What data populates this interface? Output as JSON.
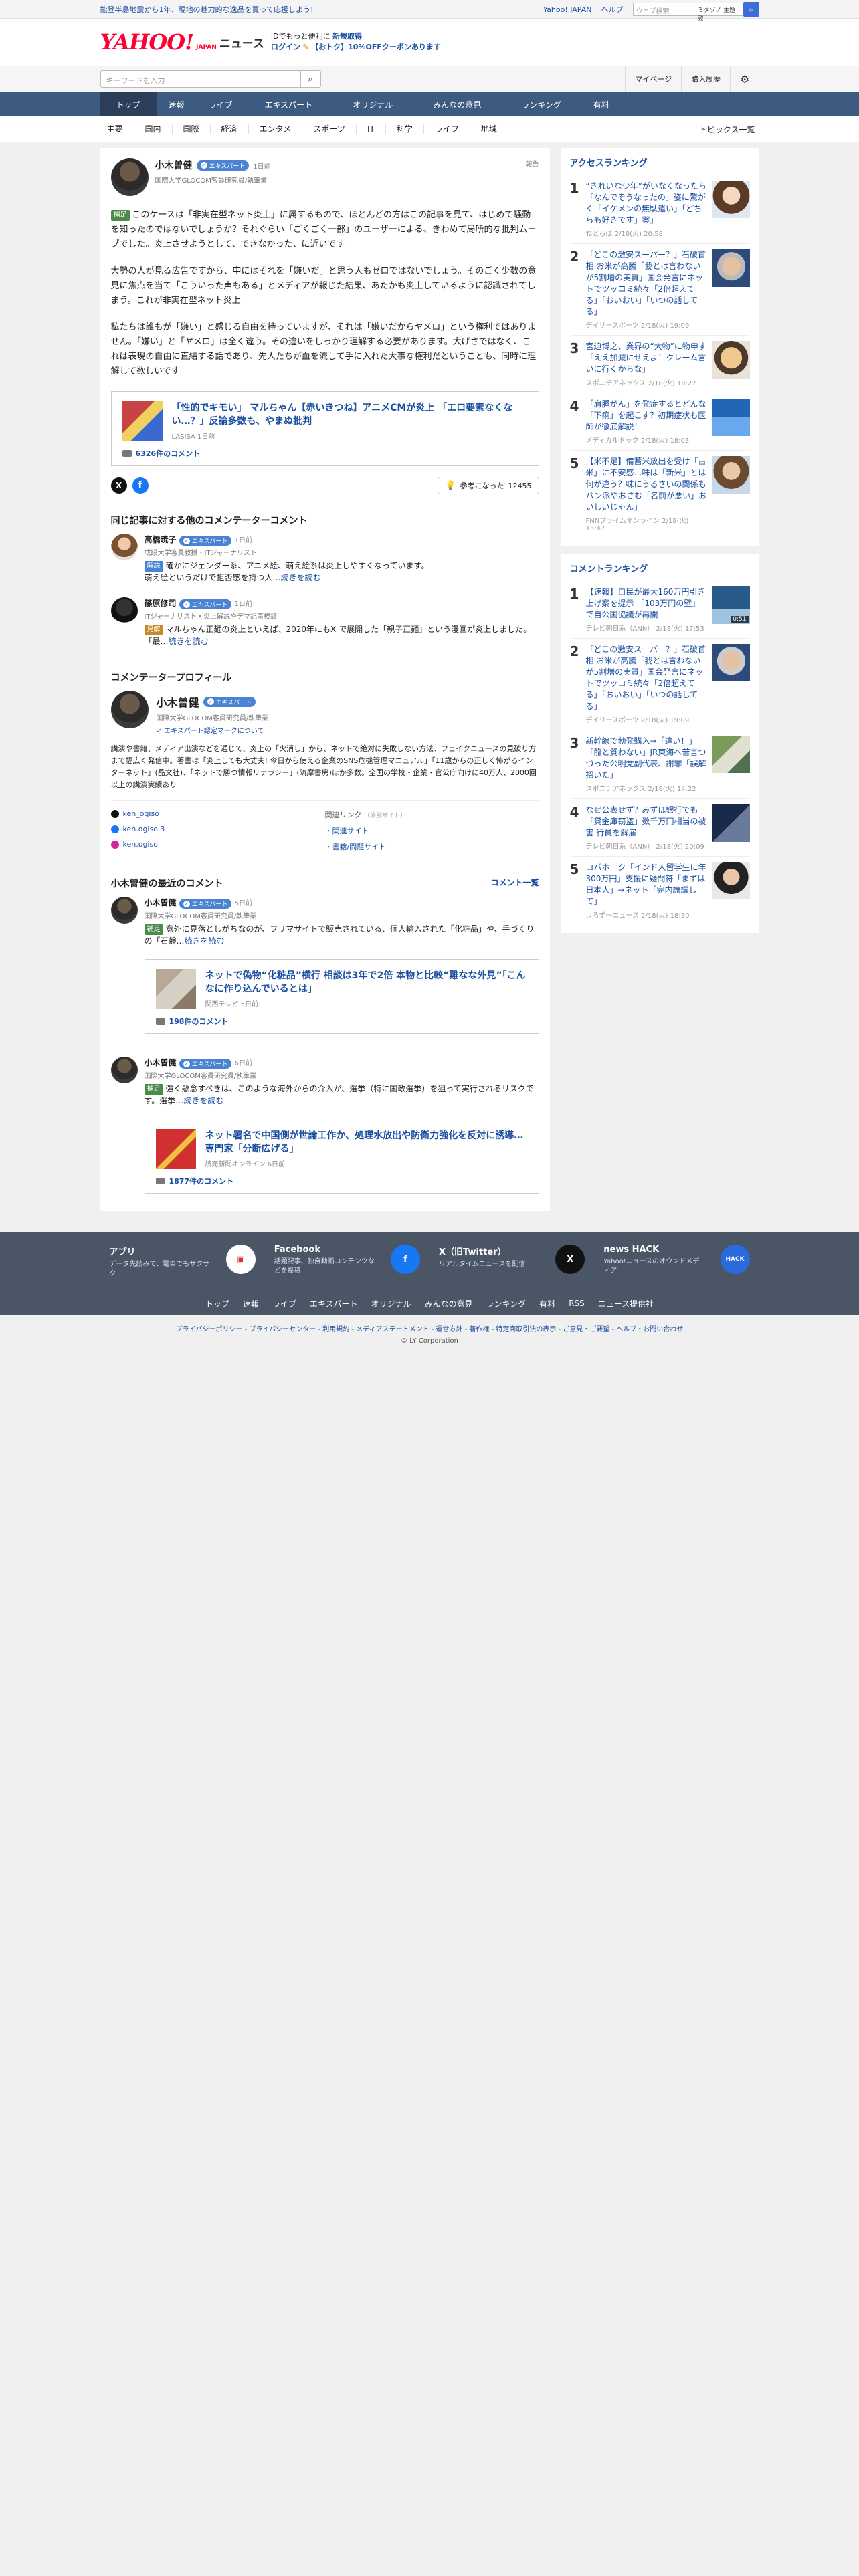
{
  "promo": {
    "text": "能登半島地震から1年、現地の魅力的な逸品を買って応援しよう!"
  },
  "topbar": {
    "yahoo_japan": "Yahoo! JAPAN",
    "help": "ヘルプ",
    "search_placeholder": "ウェブ検索",
    "search_scope": "ミタゾノ 主題歌"
  },
  "header": {
    "logo_main": "YAHOO!",
    "logo_sub": "JAPAN",
    "logo_news": "ニュース",
    "msg_line1": "IDでもっと便利に",
    "msg_line1_link": "新規取得",
    "msg_login": "ログイン",
    "msg_coupon": "【おトク】10%OFFクーポンあります"
  },
  "searchrow": {
    "placeholder": "キーワードを入力",
    "mypage": "マイページ",
    "history": "購入履歴"
  },
  "gnav": [
    "トップ",
    "速報",
    "ライブ",
    "エキスパート",
    "オリジナル",
    "みんなの意見",
    "ランキング",
    "有料"
  ],
  "snav": {
    "items": [
      "主要",
      "国内",
      "国際",
      "経済",
      "エンタメ",
      "スポーツ",
      "IT",
      "科学",
      "ライフ",
      "地域"
    ],
    "topics": "トピックス一覧"
  },
  "comment": {
    "author": "小木曽健",
    "badge": "エキスパート",
    "time": "1日前",
    "affiliation": "国際大学GLOCOM客員研究員/執筆業",
    "report": "報告",
    "tag": "補足",
    "p1": "このケースは「非実在型ネット炎上」に属するもので、ほとんどの方はこの記事を見て、はじめて騒動を知ったのではないでしょうか？それぐらい「ごくごく一部」のユーザーによる、きわめて局所的な批判ムーブでした。炎上させようとして、できなかった、に近いです",
    "p2": "大勢の人が見る広告ですから、中にはそれを「嫌いだ」と思う人もゼロではないでしょう。そのごく少数の意見に焦点を当て「こういった声もある」とメディアが報じた結果、あたかも炎上しているように認識されてしまう。これが非実在型ネット炎上",
    "p3": "私たちは誰もが「嫌い」と感じる自由を持っていますが、それは「嫌いだからヤメロ」という権利ではありません。「嫌い」と「ヤメロ」は全く違う。その違いをしっかり理解する必要があります。大げさではなく、これは表現の自由に直結する話であり、先人たちが血を流して手に入れた大事な権利だということも、同時に理解して欲しいです",
    "article_title": "「性的でキモい」 マルちゃん【赤いきつね】アニメCMが炎上 「エロ要素なくない…？」反論多数も、やまぬ批判",
    "article_source": "LASISA 1日前",
    "article_comments": "6326件のコメント",
    "helpful_label": "参考になった",
    "helpful_count": "12455"
  },
  "others": {
    "heading": "同じ記事に対する他のコメンテーターコメント",
    "items": [
      {
        "name": "高橋暁子",
        "badge": "エキスパート",
        "time": "1日前",
        "aff": "成蹊大学客員教授・ITジャーナリスト",
        "tag": "解説",
        "text": "確かにジェンダー系、アニメ絵、萌え絵系は炎上しやすくなっています。",
        "text2": "萌え絵というだけで拒否感を持つ人…",
        "more": "続きを読む"
      },
      {
        "name": "篠原修司",
        "badge": "エキスパート",
        "time": "1日前",
        "aff": "ITジャーナリスト・炎上解説やデマ記事検証",
        "tag": "見解",
        "text": "マルちゃん正麺の炎上といえば、2020年にもX で展開した「親子正麺」という漫画が炎上しました。",
        "text2": "「最…",
        "more": "続きを読む"
      }
    ]
  },
  "profile": {
    "heading": "コメンテータープロフィール",
    "name": "小木曽健",
    "badge": "エキスパート",
    "aff": "国際大学GLOCOM客員研究員/執筆業",
    "cert": "エキスパート認定マークについて",
    "bio": "講演や書籍、メディア出演などを通じて、炎上の「火消し」から、ネットで絶対に失敗しない方法、フェイクニュースの見破り方まで幅広く発信中。著書は「炎上しても大丈夫! 今日から使える企業のSNS危機管理マニュアル」「11歳からの正しく怖がるインターネット」(晶文社)、「ネットで勝つ情報リテラシー」(筑摩書房)ほか多数。全国の学校・企業・官公庁向けに40万人、2000回以上の講演実績あり",
    "sns": [
      "ken_ogiso",
      "ken.ogiso.3",
      "ken.ogiso"
    ],
    "rel_heading": "関連リンク",
    "rel_note": "（外部サイト）",
    "rel": [
      "関連サイト",
      "書籍/問題サイト"
    ]
  },
  "recent": {
    "heading": "小木曽健の最近のコメント",
    "more": "コメント一覧",
    "items": [
      {
        "name": "小木曽健",
        "badge": "エキスパート",
        "time": "5日前",
        "aff": "国際大学GLOCOM客員研究員/執筆業",
        "tag": "補足",
        "text": "意外に見落としがちなのが、フリマサイトで販売されている、個人輸入された「化粧品」や、手づくりの「石鹸…",
        "more": "続きを読む",
        "art_title": "ネットで偽物“化粧品”横行 相談は3年で2倍 本物と比較“難なな外見”「こんなに作り込んでいるとは」",
        "art_src": "関西テレビ 5日前",
        "art_cmt": "198件のコメント"
      },
      {
        "name": "小木曽健",
        "badge": "エキスパート",
        "time": "6日前",
        "aff": "国際大学GLOCOM客員研究員/執筆業",
        "tag": "補足",
        "text": "強く懸念すべきは、このような海外からの介入が、選挙（特に国政選挙）を狙って実行されるリスクです。選挙…",
        "more": "続きを読む",
        "art_title": "ネット署名で中国側が世論工作か、処理水放出や防衛力強化を反対に誘導…専門家「分断広げる」",
        "art_src": "読売新聞オンライン 6日前",
        "art_cmt": "1877件のコメント"
      }
    ]
  },
  "access_ranking": {
    "heading": "アクセスランキング",
    "items": [
      {
        "num": "1",
        "title": "“きれいな少年”がいなくなったら「なんでそうなったの」姿に驚がく「イケメンの無駄遣い」「どちらも好きです」案」",
        "meta": "ねとらぼ 2/18(火) 20:58"
      },
      {
        "num": "2",
        "title": "「どこの激安スーパー？」石破首相 お米が高騰「我とは言わないが5割増の実質」国会発言にネットでツッコミ続々「2倍超えてる」「おいおい」「いつの話してる」",
        "meta": "デイリースポーツ 2/18(火) 19:09"
      },
      {
        "num": "3",
        "title": "宮迫博之、業界の“大物”に物申す「ええ加減にせえよ！クレーム言いに行くからな」",
        "meta": "スポニチアネックス 2/18(火) 18:27"
      },
      {
        "num": "4",
        "title": "「肩腫がん」を発症するとどんな「下痢」を起こす？初期症状も医師が徹底解説！",
        "meta": "メディカルドック 2/18(火) 18:03"
      },
      {
        "num": "5",
        "title": "【米不足】備蓄米放出を受け「古米」に不安感…味は「新米」とは何が違う？味にうるさいの関係もパン派やおさむ「名前が悪い」おいしいじゃん」",
        "meta": "FNNプライムオンライン 2/18(火) 13:47"
      }
    ]
  },
  "comment_ranking": {
    "heading": "コメントランキング",
    "items": [
      {
        "num": "1",
        "title": "【速報】自民が最大160万円引き上げ案を提示 「103万円の壁」で自公国協議が再開",
        "meta": "テレビ朝日系（ANN） 2/18(火) 17:53",
        "time": "0:51"
      },
      {
        "num": "2",
        "title": "「どこの激安スーパー？」石破首相 お米が高騰「我とは言わないが5割増の実質」国会発言にネットでツッコミ続々「2倍超えてる」「おいおい」「いつの話してる」",
        "meta": "デイリースポーツ 2/18(火) 19:09",
        "time": ""
      },
      {
        "num": "3",
        "title": "新幹線で勃発購入→「違い！」「龍と質わない」JR東海へ苦言つづった公明党副代表、謝罪「誤解招いた」",
        "meta": "スポニチアネックス 2/18(火) 14:22",
        "time": ""
      },
      {
        "num": "4",
        "title": "なぜ公表せず？みずほ銀行でも「貸金庫窃盗」数千万円相当の被害 行員を解雇",
        "meta": "テレビ朝日系（ANN） 2/18(火) 20:09",
        "time": ""
      },
      {
        "num": "5",
        "title": "コバホーク「インド人留学生に年300万円」支援に疑問符「まずは日本人」→ネット「完内論議して」",
        "meta": "よろず～ニュース 2/18(火) 18:30",
        "time": ""
      }
    ]
  },
  "footer": {
    "apps": [
      {
        "title": "アプリ",
        "desc": "データ先読みで、電車でもサクサク"
      },
      {
        "title": "Facebook",
        "desc": "話題記事、独自動画コンテンツなどを投稿"
      },
      {
        "title": "X（旧Twitter）",
        "desc": "リアルタイムニュースを配信"
      },
      {
        "title": "news HACK",
        "desc": "Yahoo!ニュースのオウンドメディア"
      }
    ],
    "nav": [
      "トップ",
      "速報",
      "ライブ",
      "エキスパート",
      "オリジナル",
      "みんなの意見",
      "ランキング",
      "有料",
      "RSS",
      "ニュース提供社"
    ],
    "links": "プライバシーポリシー - プライバシーセンター - 利用規約 - メディアステートメント - 運営方針 - 著作権 - 特定商取引法の表示 - ご意見・ご要望 - ヘルプ・お問い合わせ",
    "copyright": "© LY Corporation"
  }
}
